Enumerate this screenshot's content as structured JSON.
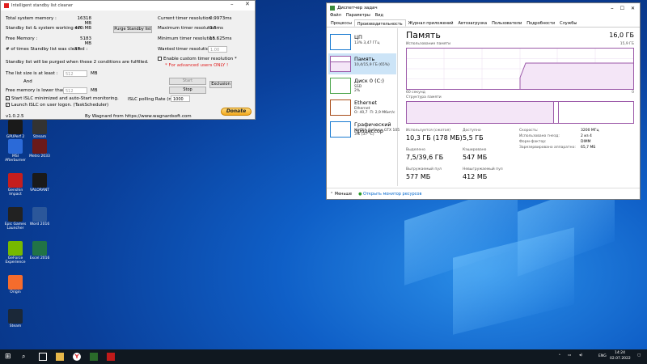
{
  "islc": {
    "title": "Intelligent standby list cleaner",
    "rows": {
      "total_memory": {
        "label": "Total system memory :",
        "value": "16318 MB"
      },
      "standby_list": {
        "label": "Standby list & system working set :",
        "value": "470 MB"
      },
      "free_memory": {
        "label": "Free Memory :",
        "value": "5183 MB"
      },
      "times_cleared": {
        "label": "# of times Standby list was cleared :",
        "value": "37"
      }
    },
    "purge_button": "Purge Standby list",
    "timer": {
      "current_label": "Current timer resolution :",
      "current_value": "0.9973ms",
      "max_label": "Maximum timer resolution :",
      "max_value": "0.5ms",
      "min_label": "Minimum timer resolution :",
      "min_value": "15.625ms",
      "wanted_label": "Wanted timer resolution :",
      "wanted_value": "1.00"
    },
    "conditions_text": "Standby list will be purged when these 2 conditions are fulfilled.",
    "list_size_label": "The list size is at least :",
    "list_size_value": "512",
    "mb": "MB",
    "and_label": "And",
    "free_memory_lower_label": "Free memory is lower than :",
    "free_memory_lower_value": "512",
    "custom_timer_label": "Enable custom timer resolution *",
    "advanced_note": "* For advanced users ONLY !",
    "start_button": "Start",
    "stop_button": "Stop",
    "exclusion_button": "Exclusion",
    "start_minimized_label": "Start ISLC minimized and auto-Start monitoring.",
    "launch_logon_label": "Launch ISLC on user logon. (TaskScheduler)",
    "polling_label": "ISLC polling Rate (ms):",
    "polling_value": "1000",
    "version": "v1.0.2.5",
    "credit": "By Wagnard from https://www.wagnardsoft.com",
    "donate": "Donate"
  },
  "desktop_icons": [
    {
      "label": "GPUPerf 2",
      "color": "#1a1a1a"
    },
    {
      "label": "Stream",
      "color": "#333333"
    },
    {
      "label": "MSI Afterburner",
      "color": "#2b6ad8"
    },
    {
      "label": "Metro 2033",
      "color": "#6a1a1a"
    },
    {
      "label": "Genshin Impact",
      "color": "#c41e1e"
    },
    {
      "label": "VALORANT",
      "color": "#1a1a1a"
    },
    {
      "label": "Epic Games Launcher",
      "color": "#222222"
    },
    {
      "label": "Word 2016",
      "color": "#2b579a"
    },
    {
      "label": "GeForce Experience",
      "color": "#76b900"
    },
    {
      "label": "Excel 2016",
      "color": "#217346"
    },
    {
      "label": "Origin",
      "color": "#f56c2d"
    },
    {
      "label": "Steam",
      "color": "#1b2838"
    }
  ],
  "taskmgr": {
    "title": "Диспетчер задач",
    "menu": [
      "Файл",
      "Параметры",
      "Вид"
    ],
    "tabs": [
      "Процессы",
      "Производительность",
      "Журнал приложений",
      "Автозагрузка",
      "Пользователи",
      "Подробности",
      "Службы"
    ],
    "sidebar": [
      {
        "name": "ЦП",
        "sub": "13%  3,47 ГГц",
        "color": "#1a7bd1"
      },
      {
        "name": "Память",
        "sub": "10,4/15,9 ГБ (65%)",
        "color": "#9c5aa9"
      },
      {
        "name": "Диск 0 (C:)",
        "sub": "SSD\n2%",
        "color": "#4da64d"
      },
      {
        "name": "Ethernet",
        "sub": "Ethernet\nО: 40,7  П: 2,9 Мбит/с",
        "color": "#a84d1a"
      },
      {
        "name": "Графический процессор",
        "sub": "NVIDIA GeForce GTX 105\n3% (37 °C)",
        "color": "#1a7bd1"
      }
    ],
    "memory": {
      "title": "Память",
      "total": "16,0 ГБ",
      "usage_label": "Использование памяти",
      "usage_max": "15,9 ГБ",
      "seconds_label": "60 секунд",
      "zero": "0",
      "structure_label": "Структура памяти",
      "in_use_label": "Используется (сжатая)",
      "in_use_value": "10,3 ГБ (178 МБ)",
      "available_label": "Доступно",
      "available_value": "5,5 ГБ",
      "committed_label": "Выделено",
      "committed_value": "7,5/39,6 ГБ",
      "cached_label": "Кэшировано",
      "cached_value": "547 МБ",
      "paged_label": "Выгружаемый пул",
      "paged_value": "577 МБ",
      "nonpaged_label": "Невыгружаемый пул",
      "nonpaged_value": "412 МБ",
      "speed_label": "Скорость:",
      "speed_value": "3200 МГц",
      "slots_label": "Использовано гнезд:",
      "slots_value": "2 из 4",
      "form_label": "Форм-фактор:",
      "form_value": "DIMM",
      "reserved_label": "Зарезервировано аппаратно:",
      "reserved_value": "65,7 МБ"
    },
    "fewer_details": "Меньше",
    "open_monitor": "Открыть монитор ресурсов"
  },
  "tray": {
    "lang": "ENG",
    "time": "14:24",
    "date": "02.07.2022"
  }
}
